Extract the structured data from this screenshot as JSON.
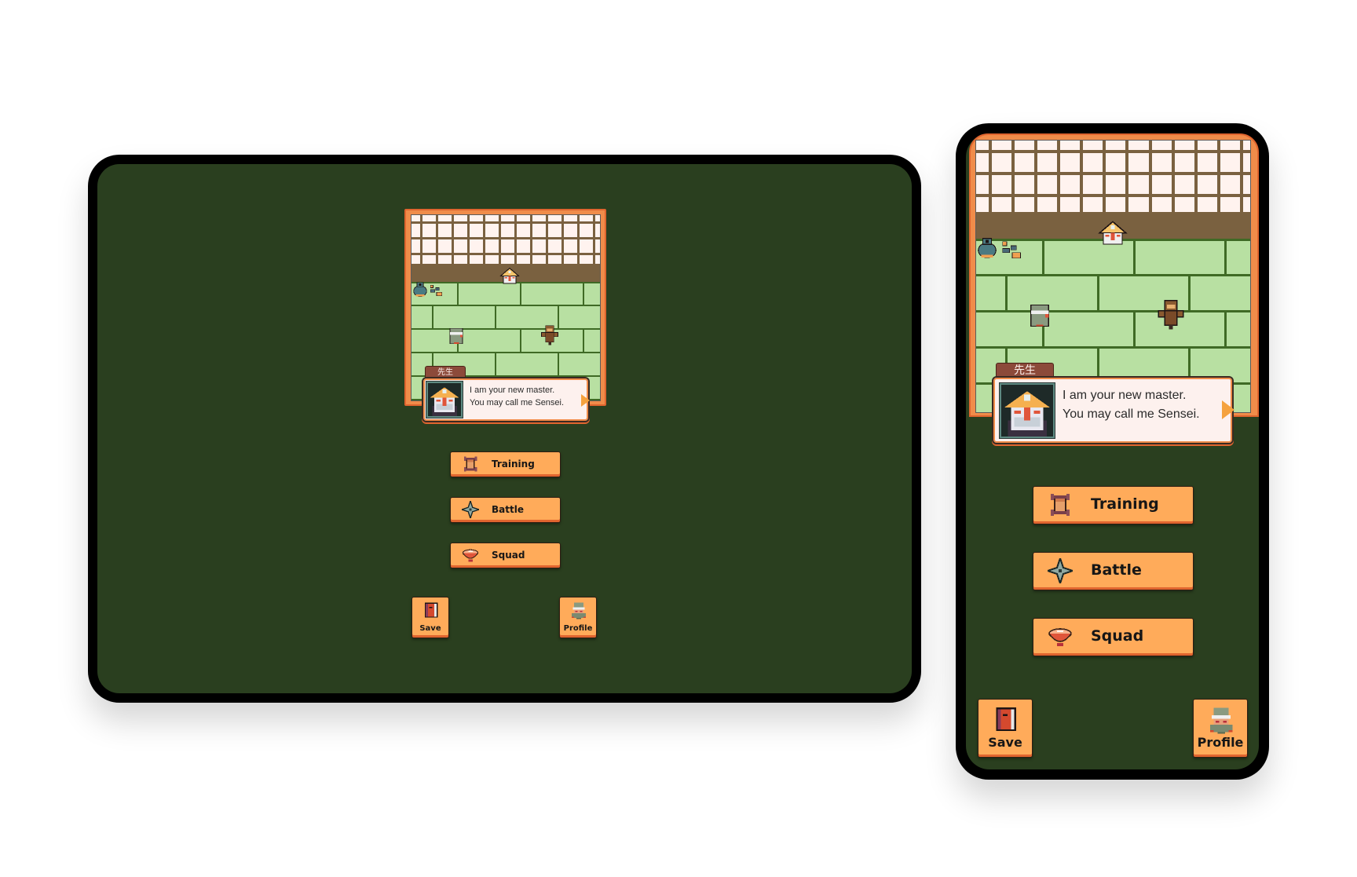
{
  "colors": {
    "screen_bg": "#2a3f1f",
    "button_bg": "#ffab5a",
    "button_shadow": "#e0652f",
    "frame_orange": "#f08c4a",
    "floor_green": "#b8e0a2",
    "floor_line": "#3f6a25",
    "wall_wood": "#7a6140",
    "shoji_paper": "#fff3ef",
    "name_tag": "#8c4a3a"
  },
  "devices": {
    "tablet": {
      "dialog": {
        "speaker": "先生",
        "lines": [
          "I am your new master.",
          "You may call me Sensei."
        ]
      },
      "menu": [
        {
          "label": "Training",
          "icon": "scroll-icon"
        },
        {
          "label": "Battle",
          "icon": "shuriken-icon"
        },
        {
          "label": "Squad",
          "icon": "bowl-icon"
        }
      ],
      "save_label": "Save",
      "profile_label": "Profile"
    },
    "phone": {
      "dialog": {
        "speaker": "先生",
        "lines": [
          "I am your new master.",
          "You may call me Sensei."
        ]
      },
      "menu": [
        {
          "label": "Training",
          "icon": "scroll-icon"
        },
        {
          "label": "Battle",
          "icon": "shuriken-icon"
        },
        {
          "label": "Squad",
          "icon": "bowl-icon"
        }
      ],
      "save_label": "Save",
      "profile_label": "Profile"
    }
  },
  "scene": {
    "characters": [
      "sensei",
      "ninja-student",
      "monkey",
      "pot-and-rocks"
    ]
  }
}
